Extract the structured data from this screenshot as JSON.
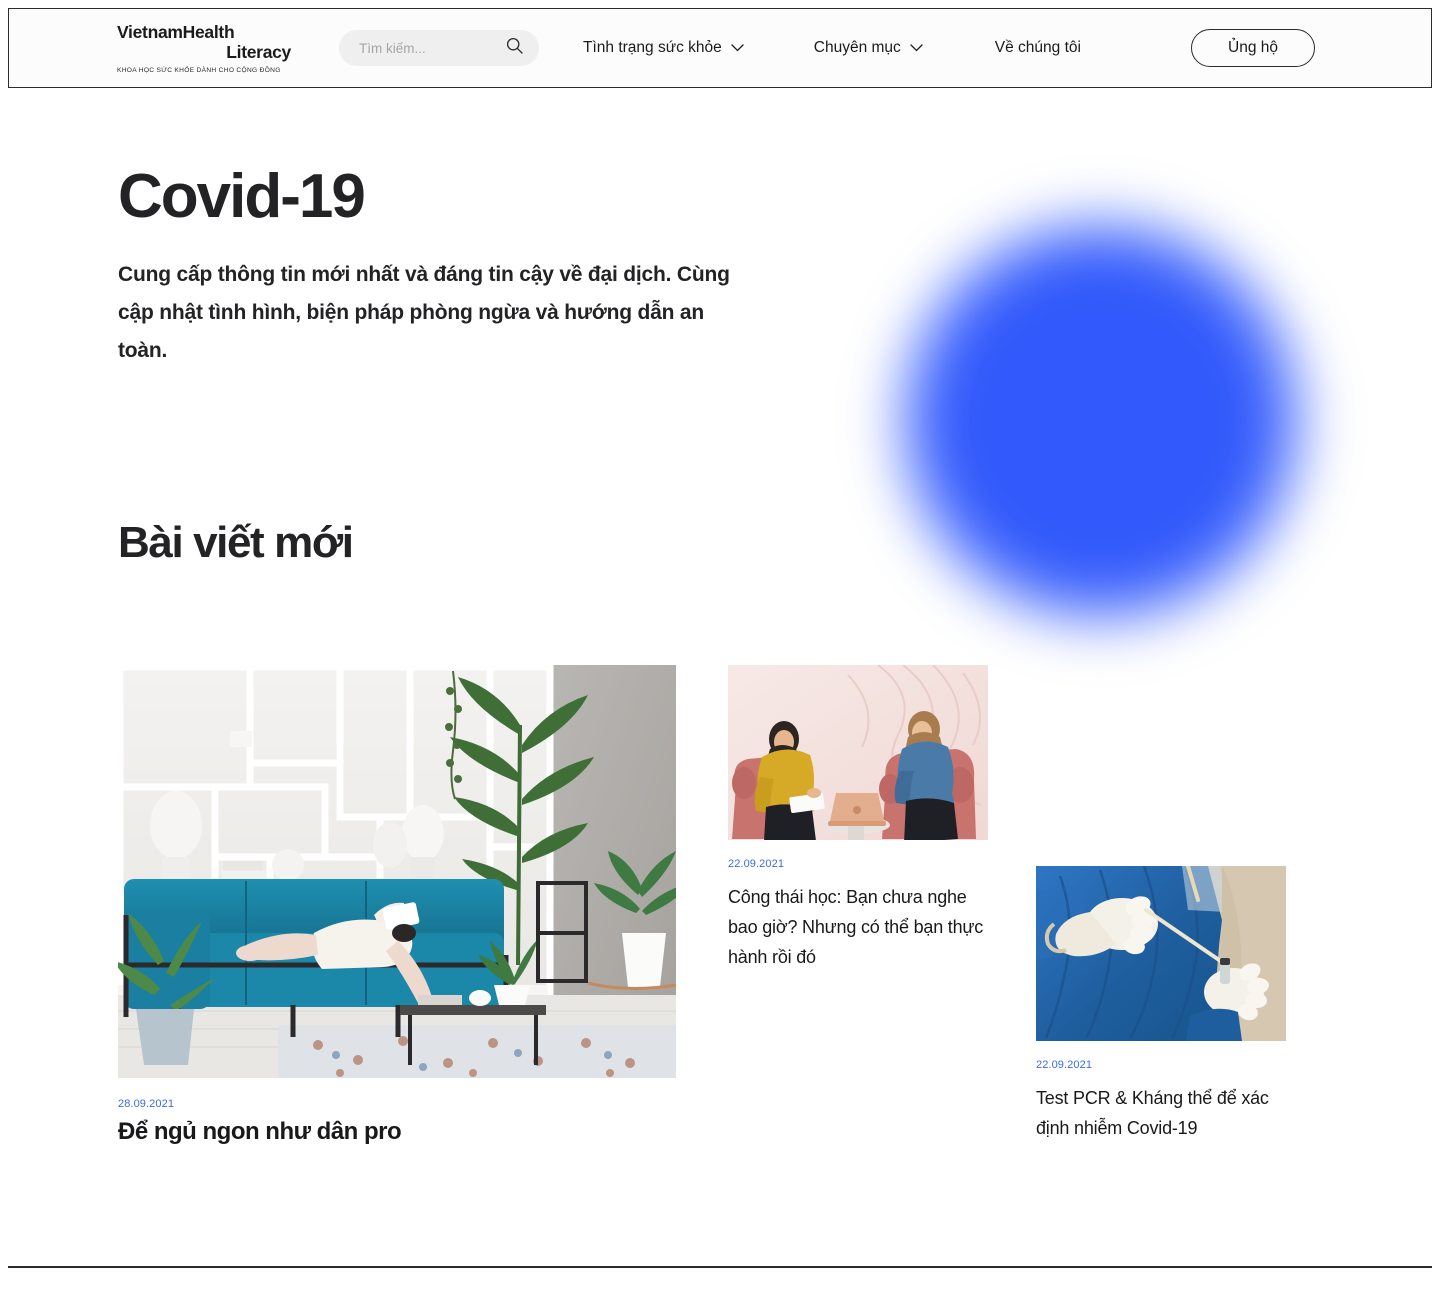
{
  "header": {
    "logo": {
      "line1": "VietnamHealth",
      "line2": "Literacy",
      "tagline": "KHOA HỌC SỨC KHỎE DÀNH CHO CỘNG ĐỒNG"
    },
    "search": {
      "placeholder": "Tìm kiếm...",
      "value": "",
      "icon": "search-icon"
    },
    "nav": [
      {
        "label": "Tình trạng sức khỏe",
        "has_dropdown": true,
        "icon": "chevron-down-icon"
      },
      {
        "label": "Chuyên mục",
        "has_dropdown": true,
        "icon": "chevron-down-icon"
      },
      {
        "label": "Về chúng tôi",
        "has_dropdown": false
      }
    ],
    "cta_label": "Ủng hộ"
  },
  "hero": {
    "title": "Covid-19",
    "description": "Cung cấp thông tin mới nhất và đáng tin cậy về đại dịch. Cùng cập nhật tình hình, biện pháp phòng ngừa và hướng dẫn an toàn."
  },
  "section": {
    "title": "Bài viết mới"
  },
  "articles": [
    {
      "date": "28.09.2021",
      "title": "Để ngủ ngon như dân pro",
      "image_alt": "woman-lying-on-blue-sofa-reading-book"
    },
    {
      "date": "22.09.2021",
      "title": "Công thái học: Bạn chưa nghe bao giờ? Nhưng có thể bạn thực hành rồi đó",
      "image_alt": "two-women-talking-with-laptop-on-pink-chairs"
    },
    {
      "date": "22.09.2021",
      "title": "Test PCR & Kháng thể để xác định nhiễm Covid-19",
      "image_alt": "medical-worker-in-blue-ppe-holding-swab"
    }
  ],
  "colors": {
    "accent_blue": "#3159fb",
    "date_blue": "#3b6be8",
    "text_dark": "#232326",
    "border_dark": "#2b2b2e",
    "search_bg": "#efefef"
  }
}
